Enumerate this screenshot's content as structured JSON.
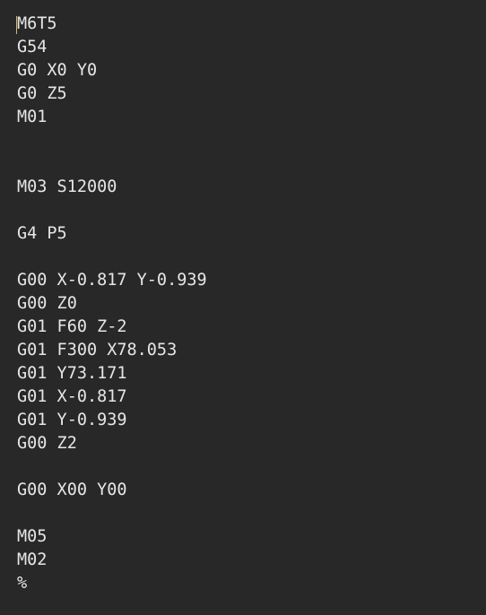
{
  "editor": {
    "lines": [
      "M6T5",
      "G54",
      "G0 X0 Y0",
      "G0 Z5",
      "M01",
      "",
      "",
      "M03 S12000",
      "",
      "G4 P5",
      "",
      "G00 X-0.817 Y-0.939",
      "G00 Z0",
      "G01 F60 Z-2",
      "G01 F300 X78.053",
      "G01 Y73.171",
      "G01 X-0.817",
      "G01 Y-0.939",
      "G00 Z2",
      "",
      "G00 X00 Y00",
      "",
      "M05",
      "M02",
      "%"
    ]
  }
}
